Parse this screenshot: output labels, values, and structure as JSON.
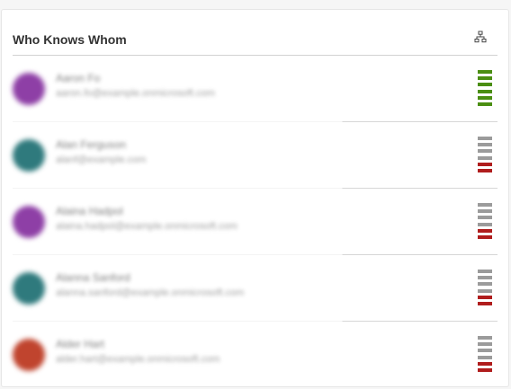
{
  "panel": {
    "title": "Who Knows Whom",
    "icon": "org-chart-icon"
  },
  "colors": {
    "strong": "#4a8e12",
    "neutral": "#9b9b9b",
    "weak": "#b01d1d"
  },
  "contacts": [
    {
      "name": "Aaron Fo",
      "email": "aaron.fo@example.onmicrosoft.com",
      "avatar_color": "#8e3fa6",
      "strength": 6
    },
    {
      "name": "Alan Ferguson",
      "email": "alanf@example.com",
      "avatar_color": "#2f7a7d",
      "strength": 2
    },
    {
      "name": "Alaina Hadpol",
      "email": "alaina.hadpol@example.onmicrosoft.com",
      "avatar_color": "#8e3fa6",
      "strength": 2
    },
    {
      "name": "Alanna Sanford",
      "email": "alanna.sanford@example.onmicrosoft.com",
      "avatar_color": "#2f7a7d",
      "strength": 2
    },
    {
      "name": "Alder Hart",
      "email": "alder.hart@example.onmicrosoft.com",
      "avatar_color": "#c0442e",
      "strength": 2
    }
  ]
}
